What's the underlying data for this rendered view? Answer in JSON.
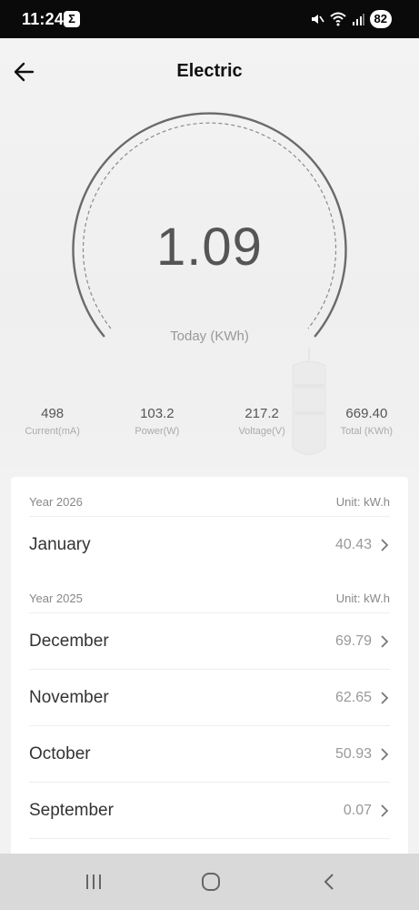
{
  "status_bar": {
    "time": "11:24",
    "app_badge": "Σ",
    "battery": "82"
  },
  "header": {
    "title": "Electric",
    "back_icon": "arrow-left-icon"
  },
  "gauge": {
    "value": "1.09",
    "label": "Today (KWh)"
  },
  "stats": [
    {
      "value": "498",
      "label": "Current(mA)"
    },
    {
      "value": "103.2",
      "label": "Power(W)"
    },
    {
      "value": "217.2",
      "label": "Voltage(V)"
    },
    {
      "value": "669.40",
      "label": "Total (KWh)"
    }
  ],
  "history": [
    {
      "year": "Year 2026",
      "unit": "Unit: kW.h",
      "months": [
        {
          "name": "January",
          "value": "40.43"
        }
      ]
    },
    {
      "year": "Year 2025",
      "unit": "Unit: kW.h",
      "months": [
        {
          "name": "December",
          "value": "69.79"
        },
        {
          "name": "November",
          "value": "62.65"
        },
        {
          "name": "October",
          "value": "50.93"
        },
        {
          "name": "September",
          "value": "0.07"
        }
      ]
    }
  ],
  "nav": {
    "recents_icon": "recents-icon",
    "home_icon": "home-icon",
    "back_icon": "back-chevron-icon"
  },
  "colors": {
    "status_bar_bg": "#0a0a0a",
    "gauge_stroke": "#666666",
    "card_bg": "#ffffff",
    "nav_bg": "#d9d9d9"
  }
}
